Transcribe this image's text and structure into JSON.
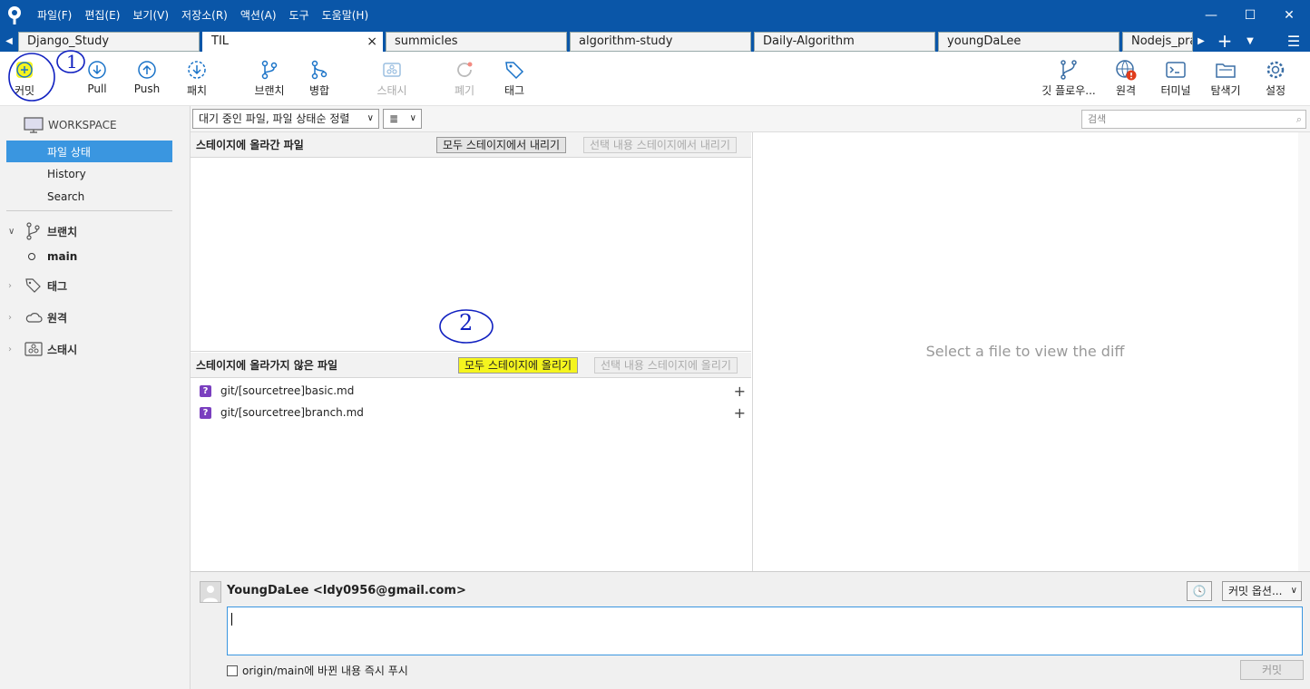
{
  "menu": [
    "파일(F)",
    "편집(E)",
    "보기(V)",
    "저장소(R)",
    "액션(A)",
    "도구",
    "도움말(H)"
  ],
  "tabs": [
    "Django_Study",
    "TIL",
    "summicles",
    "algorithm-study",
    "Daily-Algorithm",
    "youngDaLee",
    "Nodejs_pra"
  ],
  "tab_close": "×",
  "toolbar": {
    "commit": "커밋",
    "pull": "Pull",
    "push": "Push",
    "fetch": "패치",
    "branch": "브랜치",
    "merge": "병합",
    "stash": "스태시",
    "discard": "폐기",
    "tag": "태그",
    "gitflow": "깃 플로우...",
    "remote": "원격",
    "terminal": "터미널",
    "explorer": "탐색기",
    "settings": "설정"
  },
  "sidebar": {
    "workspace": "WORKSPACE",
    "file_status": "파일 상태",
    "history": "History",
    "search": "Search",
    "branches": "브랜치",
    "main": "main",
    "tags": "태그",
    "remotes": "원격",
    "stash": "스태시"
  },
  "filter": {
    "sort": "대기 중인 파일, 파일 상태순 정렬",
    "view": "≣",
    "search_placeholder": "검색"
  },
  "staged": {
    "title": "스테이지에 올라간 파일",
    "unstage_all": "모두 스테이지에서 내리기",
    "unstage_selected": "선택 내용 스테이지에서 내리기"
  },
  "unstaged": {
    "title": "스테이지에 올라가지 않은 파일",
    "stage_all": "모두 스테이지에 올리기",
    "stage_selected": "선택 내용 스테이지에 올리기",
    "files": [
      "git/[sourcetree]basic.md",
      "git/[sourcetree]branch.md"
    ]
  },
  "diff": {
    "placeholder": "Select a file to view the diff"
  },
  "commit": {
    "author": "YoungDaLee <ldy0956@gmail.com>",
    "options": "커밋 옵션...",
    "push_checkbox": "origin/main에 바뀐 내용 즉시 푸시",
    "commit_button": "커밋"
  },
  "annotations": {
    "one": "1",
    "two": "2"
  },
  "colors": {
    "titlebar": "#0a56a8",
    "selected": "#3a96e0",
    "highlight": "#f5f51e",
    "annotation": "#1020c0"
  }
}
